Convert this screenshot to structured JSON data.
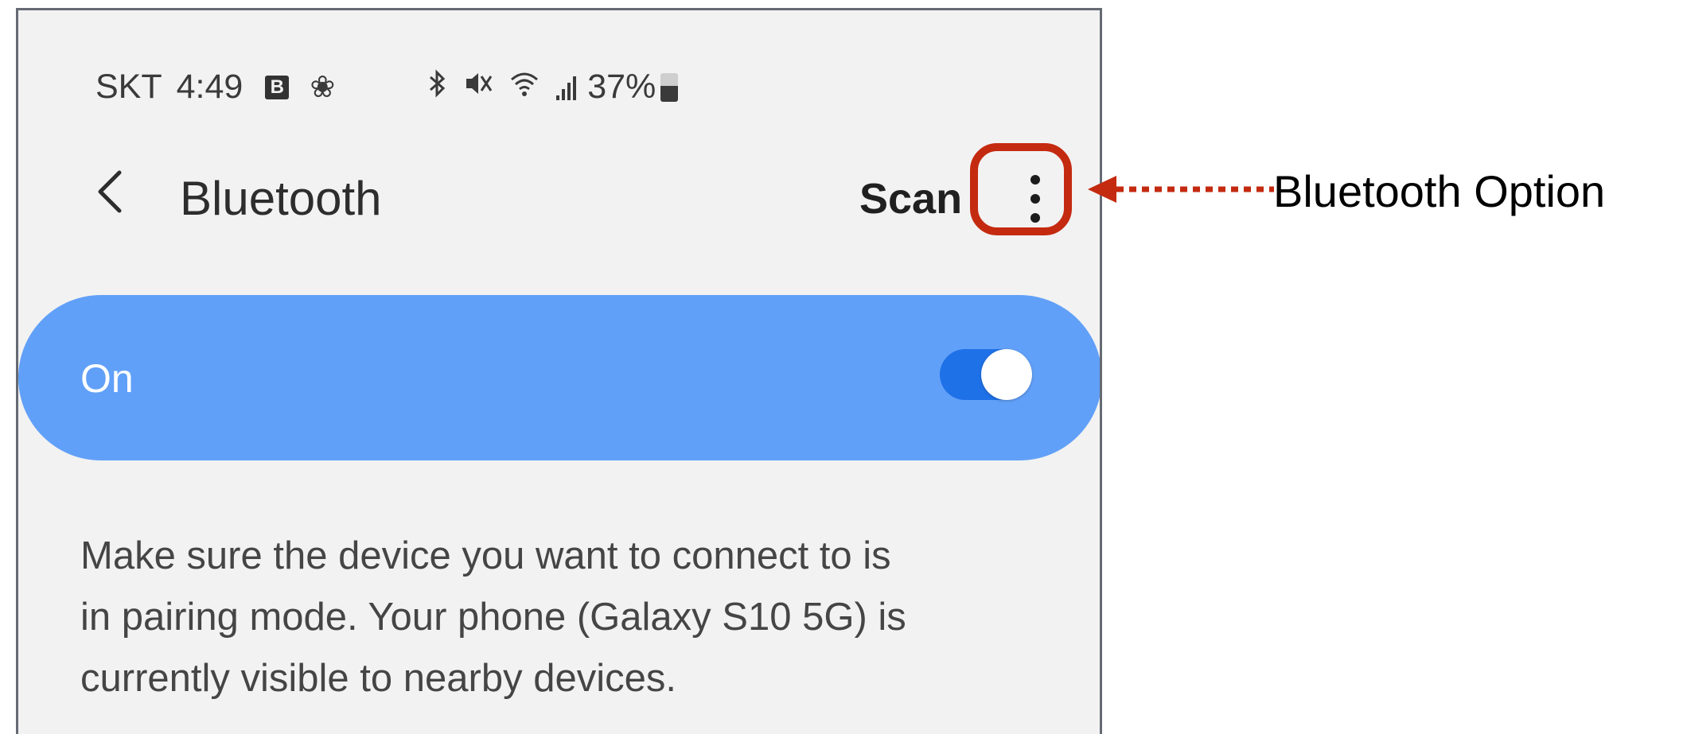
{
  "status_bar": {
    "carrier": "SKT",
    "time": "4:49",
    "notification_badge": "B",
    "icons": [
      "b-app-icon",
      "fan-icon",
      "bluetooth-icon",
      "mute-icon",
      "wifi-icon",
      "signal-icon"
    ],
    "battery": "37%"
  },
  "header": {
    "title": "Bluetooth",
    "scan_label": "Scan"
  },
  "toggle_row": {
    "label": "On",
    "state": true
  },
  "description": {
    "lines": [
      "Make sure the device you want to connect to is",
      "in pairing mode. Your phone (Galaxy S10 5G) is",
      "currently visible to nearby devices."
    ]
  },
  "annotation": {
    "label": "Bluetooth Option",
    "color": "#c42a10"
  },
  "colors": {
    "toggle_bar": "#61a0f8",
    "toggle_track": "#1f71e8",
    "background": "#f2f2f2"
  }
}
